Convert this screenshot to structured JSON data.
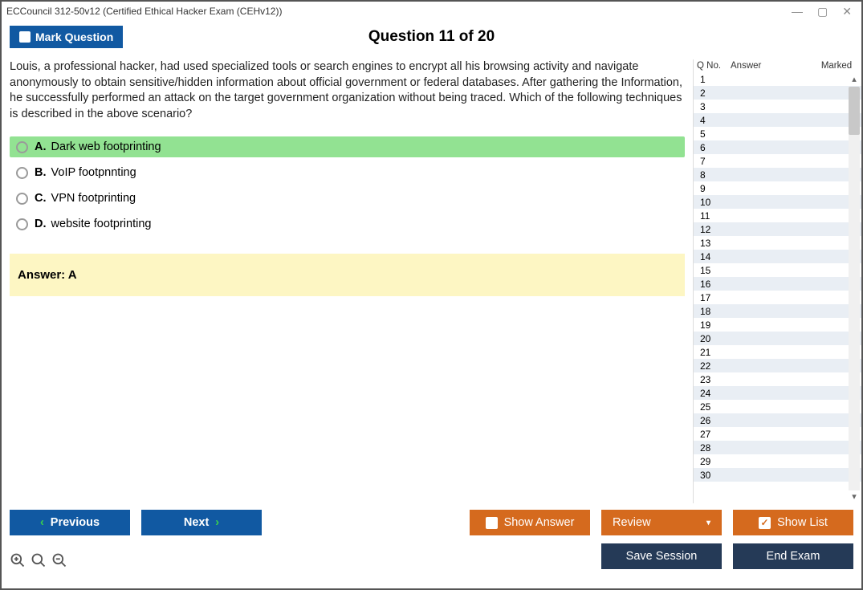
{
  "window": {
    "title": "ECCouncil 312-50v12 (Certified Ethical Hacker Exam (CEHv12))"
  },
  "header": {
    "mark_label": "Mark Question",
    "counter": "Question 11 of 20"
  },
  "question": {
    "text": "Louis, a professional hacker, had used specialized tools or search engines to encrypt all his browsing activity and navigate anonymously to obtain sensitive/hidden information about official government or federal databases. After gathering the Information, he successfully performed an attack on the target government organization without being traced. Which of the following techniques is described in the above scenario?",
    "options": [
      {
        "letter": "A.",
        "text": "Dark web footprinting",
        "correct": true
      },
      {
        "letter": "B.",
        "text": "VoIP footpnnting",
        "correct": false
      },
      {
        "letter": "C.",
        "text": "VPN footprinting",
        "correct": false
      },
      {
        "letter": "D.",
        "text": "website footprinting",
        "correct": false
      }
    ],
    "answer_label": "Answer: A"
  },
  "list": {
    "headers": {
      "q": "Q No.",
      "a": "Answer",
      "m": "Marked"
    },
    "rows": [
      1,
      2,
      3,
      4,
      5,
      6,
      7,
      8,
      9,
      10,
      11,
      12,
      13,
      14,
      15,
      16,
      17,
      18,
      19,
      20,
      21,
      22,
      23,
      24,
      25,
      26,
      27,
      28,
      29,
      30
    ]
  },
  "footer": {
    "previous": "Previous",
    "next": "Next",
    "show_answer": "Show Answer",
    "review": "Review",
    "show_list": "Show List",
    "save_session": "Save Session",
    "end_exam": "End Exam"
  }
}
